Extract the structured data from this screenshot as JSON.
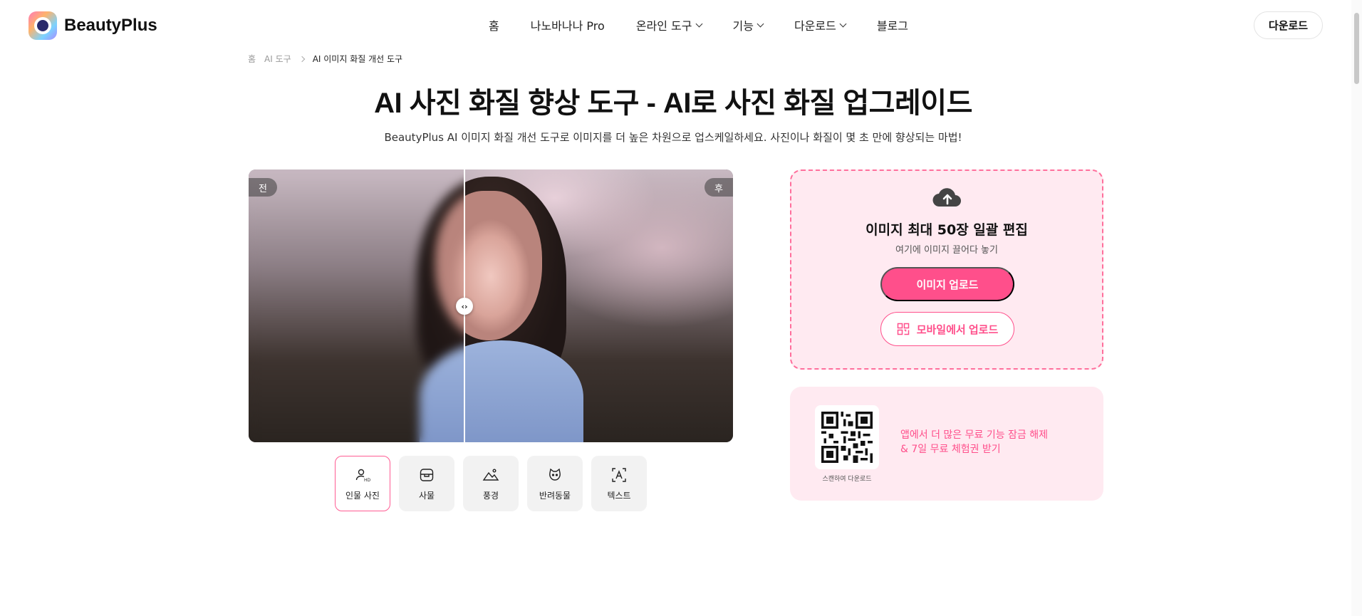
{
  "brand": {
    "name": "BeautyPlus"
  },
  "nav": {
    "items": [
      {
        "label": "홈",
        "dropdown": false
      },
      {
        "label": "나노바나나 Pro",
        "dropdown": false
      },
      {
        "label": "온라인 도구",
        "dropdown": true
      },
      {
        "label": "기능",
        "dropdown": true
      },
      {
        "label": "다운로드",
        "dropdown": true
      },
      {
        "label": "블로그",
        "dropdown": false
      }
    ],
    "download_button": "다운로드"
  },
  "breadcrumb": [
    "홈",
    "AI 도구",
    "AI 이미지 화질 개선 도구"
  ],
  "hero": {
    "title": "AI 사진 화질 향상 도구 - AI로 사진 화질 업그레이드",
    "subtitle": "BeautyPlus AI 이미지 화질 개선 도구로 이미지를 더 높은 차원으로 업스케일하세요. 사진이나 화질이 몇 초 만에 향상되는 마법!"
  },
  "compare": {
    "before_label": "전",
    "after_label": "후",
    "split_fraction": 0.445
  },
  "categories": [
    {
      "label": "인물 사진",
      "icon": "portrait-hd-icon",
      "active": true
    },
    {
      "label": "사물",
      "icon": "object-icon",
      "active": false
    },
    {
      "label": "풍경",
      "icon": "landscape-icon",
      "active": false
    },
    {
      "label": "반려동물",
      "icon": "pet-icon",
      "active": false
    },
    {
      "label": "텍스트",
      "icon": "text-icon",
      "active": false
    }
  ],
  "upload": {
    "title": "이미지 최대 50장 일괄 편집",
    "subtitle": "여기에 이미지 끌어다 놓기",
    "upload_button": "이미지 업로드",
    "mobile_button": "모바일에서 업로드"
  },
  "promo": {
    "qr_caption": "스캔하여 다운로드",
    "line1": "앱에서 더 많은 무료 기능 잠금 해제",
    "line2": "& 7일 무료 체험권 받기"
  },
  "colors": {
    "accent": "#ff4f8b",
    "upload_bg": "#ffeaf1",
    "border": "#ff6f9c"
  }
}
